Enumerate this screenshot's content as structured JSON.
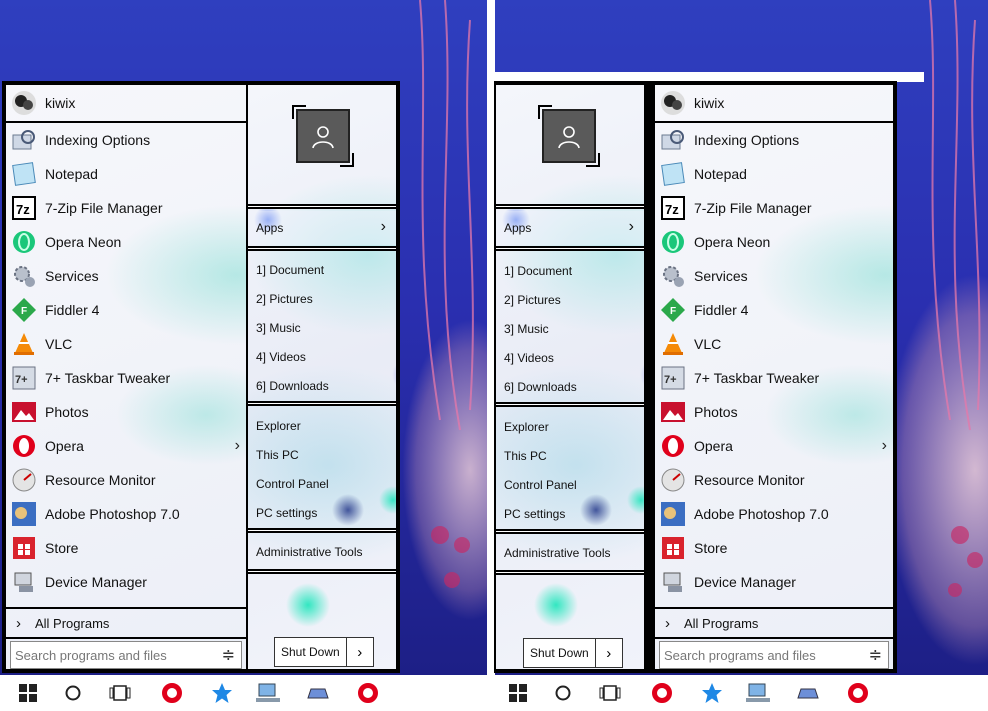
{
  "user": {
    "name": "kiwix"
  },
  "apps": [
    {
      "label": "Indexing Options",
      "icon": "indexing-options-icon",
      "has_submenu": false
    },
    {
      "label": "Notepad",
      "icon": "notepad-icon",
      "has_submenu": false
    },
    {
      "label": "7-Zip File Manager",
      "icon": "7zip-icon",
      "icon_text": "7z",
      "has_submenu": false
    },
    {
      "label": "Opera Neon",
      "icon": "opera-neon-icon",
      "has_submenu": false
    },
    {
      "label": "Services",
      "icon": "services-gear-icon",
      "has_submenu": false
    },
    {
      "label": "Fiddler 4",
      "icon": "fiddler-icon",
      "icon_text": "F",
      "has_submenu": false
    },
    {
      "label": "VLC",
      "icon": "vlc-cone-icon",
      "has_submenu": false
    },
    {
      "label": "7+ Taskbar Tweaker",
      "icon": "taskbar-tweaker-icon",
      "icon_text": "7+",
      "has_submenu": false
    },
    {
      "label": "Photos",
      "icon": "photos-icon",
      "has_submenu": false
    },
    {
      "label": "Opera",
      "icon": "opera-icon",
      "has_submenu": true
    },
    {
      "label": "Resource Monitor",
      "icon": "resource-monitor-icon",
      "has_submenu": false
    },
    {
      "label": "Adobe Photoshop 7.0",
      "icon": "photoshop-icon",
      "has_submenu": false
    },
    {
      "label": "Store",
      "icon": "store-icon",
      "has_submenu": false
    },
    {
      "label": "Device Manager",
      "icon": "device-manager-icon",
      "has_submenu": false
    }
  ],
  "all_programs": "All Programs",
  "search": {
    "placeholder": "Search programs and files"
  },
  "apps_button": "Apps",
  "libraries": [
    "1] Document",
    "2] Pictures",
    "3] Music",
    "4] Videos",
    "6] Downloads"
  ],
  "system": [
    "Explorer",
    "This PC",
    "Control Panel",
    "PC settings"
  ],
  "admin": "Administrative Tools",
  "shutdown": {
    "label": "Shut Down"
  },
  "taskbar": [
    "windows-start-icon",
    "cortana-circle-icon",
    "task-view-icon",
    "opera-icon",
    "star-app-icon",
    "monitor-app-icon",
    "laptop-app-icon",
    "opera-icon"
  ],
  "colors": {
    "accent_opera": "#e0001b",
    "avatar_bg": "#5a5a5a",
    "panel_border": "#000000"
  }
}
